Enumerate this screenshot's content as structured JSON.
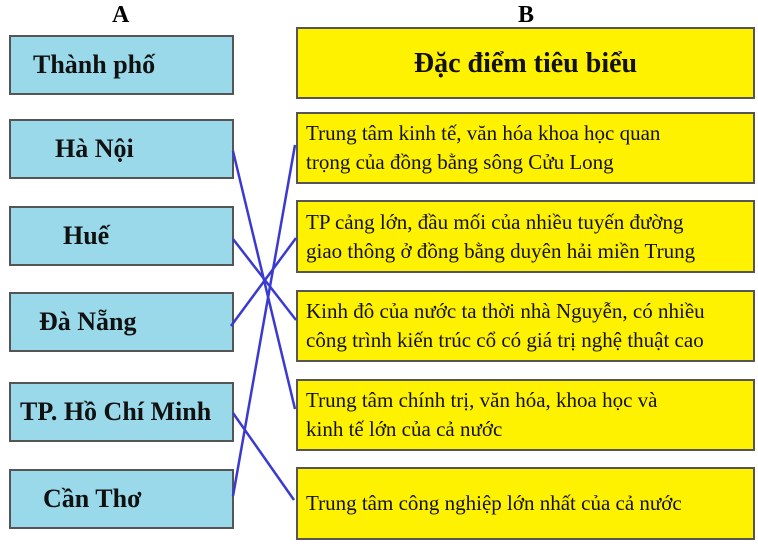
{
  "columns": {
    "a_label": "A",
    "b_label": "B"
  },
  "column_a": {
    "header": "Thành phố",
    "items": [
      "Hà Nội",
      "Huế",
      "Đà Nẵng",
      "TP. Hồ Chí Minh",
      "Cần Thơ"
    ]
  },
  "column_b": {
    "header": "Đặc điểm tiêu biểu",
    "items": [
      {
        "line1": "Trung tâm kinh tế, văn hóa khoa học quan",
        "line2": "trọng của đồng bằng sông Cửu Long"
      },
      {
        "line1": "TP cảng lớn, đầu mối của nhiều tuyến đường",
        "line2": "giao thông ở đồng bằng duyên hải miền Trung"
      },
      {
        "line1": "Kinh đô của nước ta thời nhà Nguyễn, có nhiều",
        "line2": "công trình kiến trúc cổ có giá trị nghệ thuật cao"
      },
      {
        "line1": "Trung tâm chính trị, văn hóa, khoa học và",
        "line2": "kinh tế lớn của cả nước"
      },
      {
        "line1": "Trung tâm công nghiệp lớn nhất của cả nước",
        "line2": ""
      }
    ]
  },
  "connections": [
    {
      "from": "Hà Nội",
      "to_index": 3
    },
    {
      "from": "Huế",
      "to_index": 2
    },
    {
      "from": "Đà Nẵng",
      "to_index": 1
    },
    {
      "from": "TP. Hồ Chí Minh",
      "to_index": 4
    },
    {
      "from": "Cần Thơ",
      "to_index": 0
    }
  ],
  "colors": {
    "a_box": "#99d9ea",
    "b_box": "#fff200",
    "line": "#3a3ad0"
  }
}
